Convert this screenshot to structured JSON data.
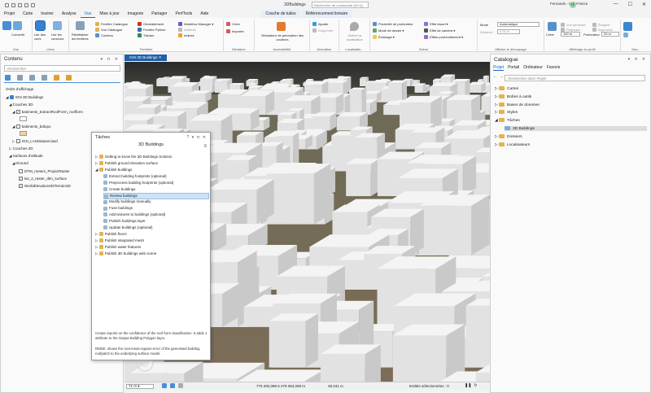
{
  "window": {
    "title": "3DBuildings",
    "search_placeholder": "Rechercher de commande (Al+Q)",
    "user": "Fernando - Esri France",
    "avatar": "FP",
    "min": "—",
    "max": "☐",
    "close": "✕"
  },
  "tabs": [
    {
      "label": "Projet"
    },
    {
      "label": "Carte"
    },
    {
      "label": "Insérer"
    },
    {
      "label": "Analyse"
    },
    {
      "label": "Vue",
      "active": true
    },
    {
      "label": "Mise à jour"
    },
    {
      "label": "Imagerie"
    },
    {
      "label": "Partager"
    },
    {
      "label": "PerfTools"
    },
    {
      "label": "Aide"
    },
    {
      "label": "Couche de tuiles",
      "contextual": true
    },
    {
      "label": "Référencement linéaire",
      "contextual": true
    }
  ],
  "ribbon": {
    "vue": {
      "label": "Vue",
      "convertir": "Convertir"
    },
    "liens": {
      "label": "Liens",
      "lier_vues": "Lier des vues",
      "lier_curseurs": "Lier les curseurs"
    },
    "fenetres": {
      "label": "Fenêtres",
      "reinit": "Réinitialiser les fenêtres",
      "fen_catalogue": "Fenêtre Catalogue",
      "vue_catalogue": "Vue Catalogue",
      "contenu": "Contenu",
      "geotraitement": "Géotraitement",
      "fen_python": "Fenêtre Python",
      "taches": "Tâches",
      "workflow": "Workflow Manager",
      "attributs": "Attributs",
      "indices": "Indices"
    },
    "miniature": {
      "label": "Miniature",
      "creer": "Créer",
      "importer": "Importer"
    },
    "accessibilite": {
      "label": "Accessibilité",
      "simulateur": "Simulateur de perception des couleurs"
    },
    "animation": {
      "label": "Animation",
      "ajouter": "Ajouter",
      "supprimer": "Supprimer"
    },
    "localisation": {
      "label": "Localisatio...",
      "activer": "Activer la localisation"
    },
    "scene": {
      "label": "Scène",
      "proximite": "Proximité de profondeur",
      "mode_dessin": "Mode de dessin",
      "eclairage": "Éclairage",
      "effet_visuel": "Effet visuel",
      "effet_camera": "Effet de caméra",
      "effets_post": "Effets post-traitement"
    },
    "decoupage": {
      "label": "Afficher le découpage",
      "mode": "Mode",
      "mode_value": "Automatique",
      "distance": "Distance",
      "distance_value": "0,00 m"
    },
    "profil": {
      "label": "Affichage du profil",
      "creer": "Créer",
      "vue_generale": "Vue générale",
      "reglages": "Réglages",
      "eloigner": "Éloigner",
      "approcher": "Approcher",
      "profondeur": "Profondeur",
      "profondeur_value": "20 m",
      "largeur_value": "100 m"
    },
    "nav": {
      "label": "Nav..."
    }
  },
  "contents": {
    "title": "Contenu",
    "controls": "▾ ⊓ ✕",
    "search_placeholder": "Rechercher",
    "drawing_order": "Ordre d'affichage",
    "map_name": "IGN 3D Buildings",
    "couches3d": "Couches 3D",
    "layer1": "batiments_ExtractRoofForm_roofform",
    "layer2": "batiments_bdtopo",
    "layer3": "IGN_LASDataset.lasd",
    "couches2d": "Couches 2D",
    "surfaces": "Surfaces d'altitude",
    "ground": "Ground",
    "surf1": "DTM_meters_ProjectRaster",
    "surf2": "las_2_raster_dtm_surface",
    "surf3": "WorldElevation3D/Terrain3D"
  },
  "map": {
    "tab_label": "IGN 3D Buildings",
    "scale": "71 m",
    "coords": "775 292,088 6 279 363,289 m",
    "elevation": "48,441 m",
    "selected": "Entités sélectionnées : 0"
  },
  "tasks": {
    "title": "Tâches",
    "controls": "? ▾ ⊓ ✕",
    "project": "3D Buildings",
    "items": [
      {
        "label": "Getting to know the 3D Buildings Solution",
        "level": 0
      },
      {
        "label": "Publish ground elevation surface",
        "level": 0
      },
      {
        "label": "Publish buildings",
        "level": 0,
        "expanded": true
      },
      {
        "label": "Extract building footprints (optional)",
        "level": 1
      },
      {
        "label": "Preprocess building footprints (optional)",
        "level": 1
      },
      {
        "label": "Create buildings",
        "level": 1
      },
      {
        "label": "Review buildings",
        "level": 1,
        "selected": true
      },
      {
        "label": "Modify buildings manually",
        "level": 1
      },
      {
        "label": "Fuse buildings",
        "level": 1
      },
      {
        "label": "Add textures to buildings (optional)",
        "level": 1
      },
      {
        "label": "Publish buildings layer",
        "level": 1
      },
      {
        "label": "Update buildings (optional)",
        "level": 1
      },
      {
        "label": "Publish floors",
        "level": 0
      },
      {
        "label": "Publish integrated mesh",
        "level": 0
      },
      {
        "label": "Publish water features",
        "level": 0
      },
      {
        "label": "Publish 3D buildings web scene",
        "level": 0
      }
    ],
    "description1": "Create reports on the confidence of the roof form classification. It adds 1 attribute to the Output Building Polygon layer.",
    "description2": "RMSE: shows the root-mean-square-error of the generated building roofpatch to the underlying surface model."
  },
  "catalog": {
    "title": "Catalogue",
    "controls": "▾ ⊓ ✕",
    "tabs": [
      "Projet",
      "Portail",
      "Ordinateur",
      "Favoris"
    ],
    "search_placeholder": "Rechercher dans Projet",
    "items": [
      {
        "label": "Cartes",
        "level": 0
      },
      {
        "label": "Boîtes à outils",
        "level": 0
      },
      {
        "label": "Bases de données",
        "level": 0
      },
      {
        "label": "Styles",
        "level": 0
      },
      {
        "label": "Tâches",
        "level": 0,
        "expanded": true
      },
      {
        "label": "3D Buildings",
        "level": 1,
        "selected": true
      },
      {
        "label": "Dossiers",
        "level": 0
      },
      {
        "label": "Localisateurs",
        "level": 0
      }
    ]
  },
  "colors": {
    "accent": "#1667c0",
    "maptab": "#1f5fa8",
    "folder": "#e4b24e",
    "selected_row": "#cde3f7"
  }
}
